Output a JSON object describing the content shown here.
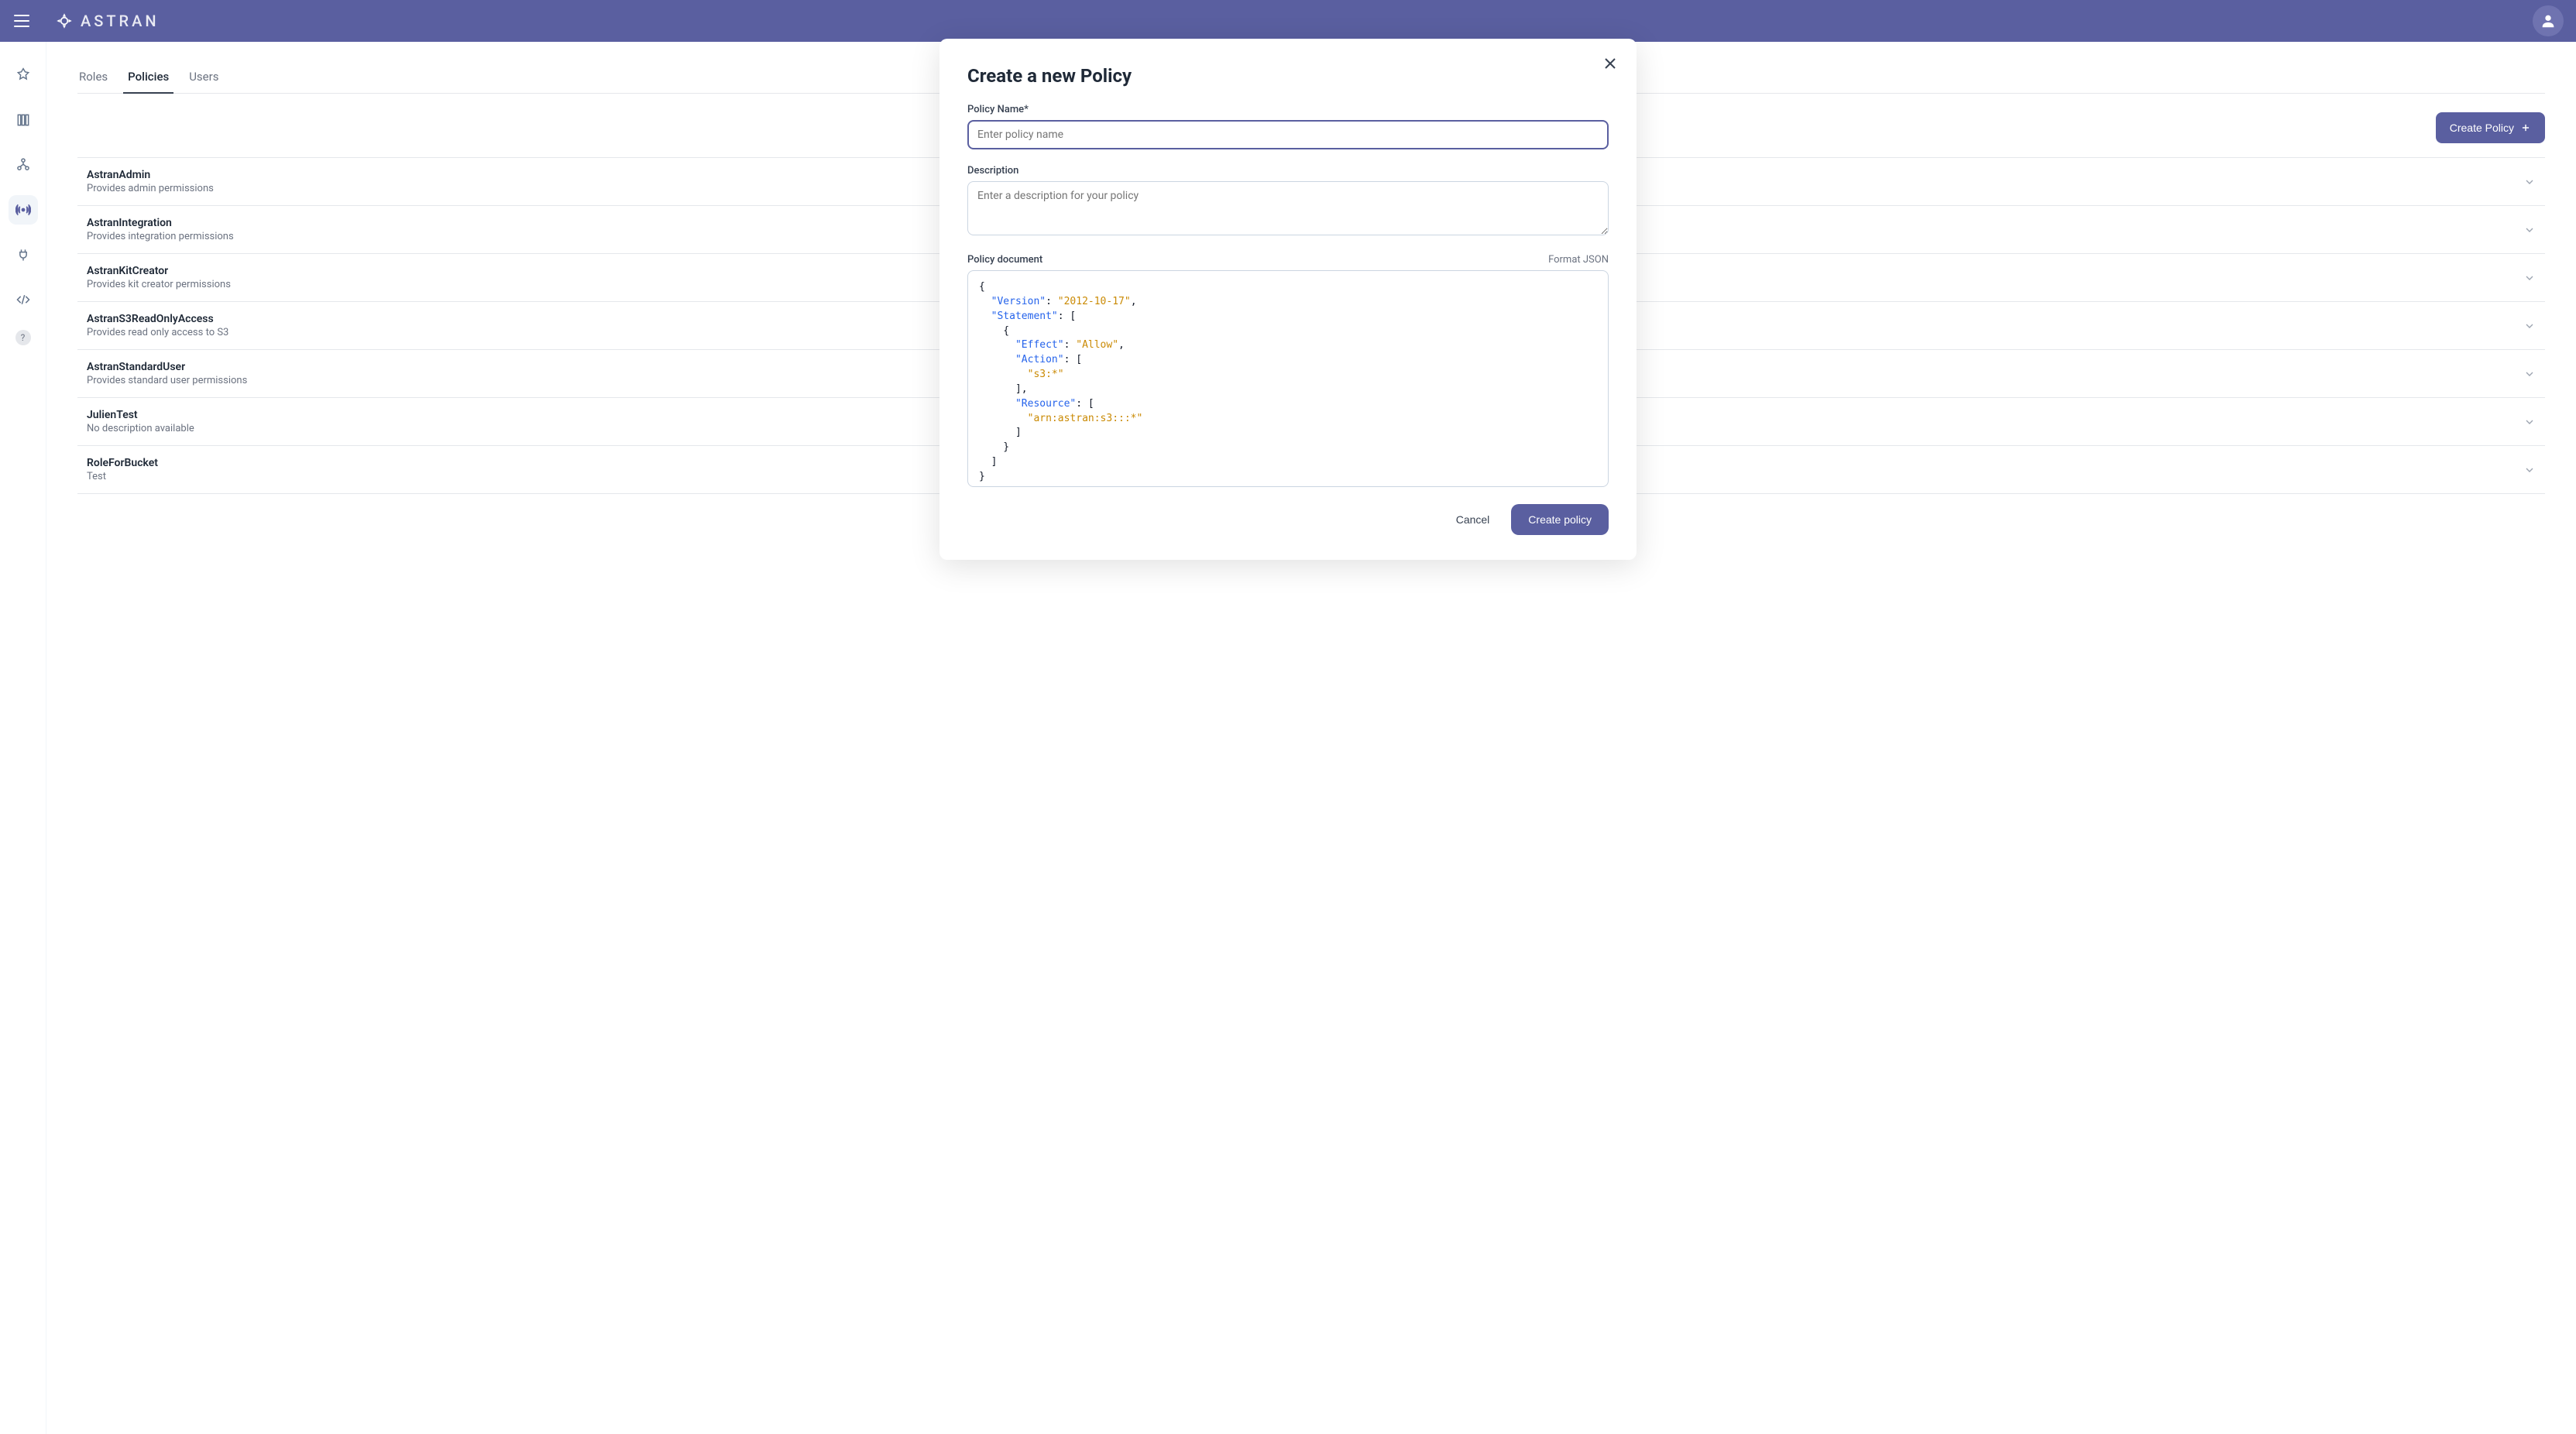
{
  "brand": {
    "name": "ASTRAN"
  },
  "header": {
    "avatar_alt": "User avatar"
  },
  "sidebar": {
    "items": [
      {
        "icon": "app-icon",
        "active": false
      },
      {
        "icon": "library-icon",
        "active": false
      },
      {
        "icon": "org-icon",
        "active": false
      },
      {
        "icon": "broadcast-icon",
        "active": true
      },
      {
        "icon": "plug-icon",
        "active": false
      },
      {
        "icon": "code-icon",
        "active": false
      }
    ],
    "help_label": "?"
  },
  "tabs": [
    {
      "label": "Roles",
      "active": false
    },
    {
      "label": "Policies",
      "active": true
    },
    {
      "label": "Users",
      "active": false
    }
  ],
  "toolbar": {
    "create_policy_label": "Create Policy"
  },
  "policies": [
    {
      "name": "AstranAdmin",
      "desc": "Provides admin permissions"
    },
    {
      "name": "AstranIntegration",
      "desc": "Provides integration permissions"
    },
    {
      "name": "AstranKitCreator",
      "desc": "Provides kit creator permissions"
    },
    {
      "name": "AstranS3ReadOnlyAccess",
      "desc": "Provides read only access to S3"
    },
    {
      "name": "AstranStandardUser",
      "desc": "Provides standard user permissions"
    },
    {
      "name": "JulienTest",
      "desc": "No description available"
    },
    {
      "name": "RoleForBucket",
      "desc": "Test"
    }
  ],
  "modal": {
    "title": "Create a new Policy",
    "policy_name_label": "Policy Name*",
    "policy_name_placeholder": "Enter policy name",
    "policy_name_value": "",
    "description_label": "Description",
    "description_placeholder": "Enter a description for your policy",
    "description_value": "",
    "document_label": "Policy document",
    "format_json_label": "Format JSON",
    "document_value": "{\n  \"Version\": \"2012-10-17\",\n  \"Statement\": [\n    {\n      \"Effect\": \"Allow\",\n      \"Action\": [\n        \"s3:*\"\n      ],\n      \"Resource\": [\n        \"arn:astran:s3:::*\"\n      ]\n    }\n  ]\n}",
    "document_tokens": [
      {
        "t": "{",
        "c": "punc"
      },
      {
        "t": "\n  ",
        "c": "punc"
      },
      {
        "t": "\"Version\"",
        "c": "key"
      },
      {
        "t": ": ",
        "c": "punc"
      },
      {
        "t": "\"2012-10-17\"",
        "c": "str"
      },
      {
        "t": ",\n  ",
        "c": "punc"
      },
      {
        "t": "\"Statement\"",
        "c": "key"
      },
      {
        "t": ": [\n    {\n      ",
        "c": "punc"
      },
      {
        "t": "\"Effect\"",
        "c": "key"
      },
      {
        "t": ": ",
        "c": "punc"
      },
      {
        "t": "\"Allow\"",
        "c": "str"
      },
      {
        "t": ",\n      ",
        "c": "punc"
      },
      {
        "t": "\"Action\"",
        "c": "key"
      },
      {
        "t": ": [\n        ",
        "c": "punc"
      },
      {
        "t": "\"s3:*\"",
        "c": "str"
      },
      {
        "t": "\n      ],\n      ",
        "c": "punc"
      },
      {
        "t": "\"Resource\"",
        "c": "key"
      },
      {
        "t": ": [\n        ",
        "c": "punc"
      },
      {
        "t": "\"arn:astran:s3:::*\"",
        "c": "str"
      },
      {
        "t": "\n      ]\n    }\n  ]\n}",
        "c": "punc"
      }
    ],
    "cancel_label": "Cancel",
    "submit_label": "Create policy"
  }
}
